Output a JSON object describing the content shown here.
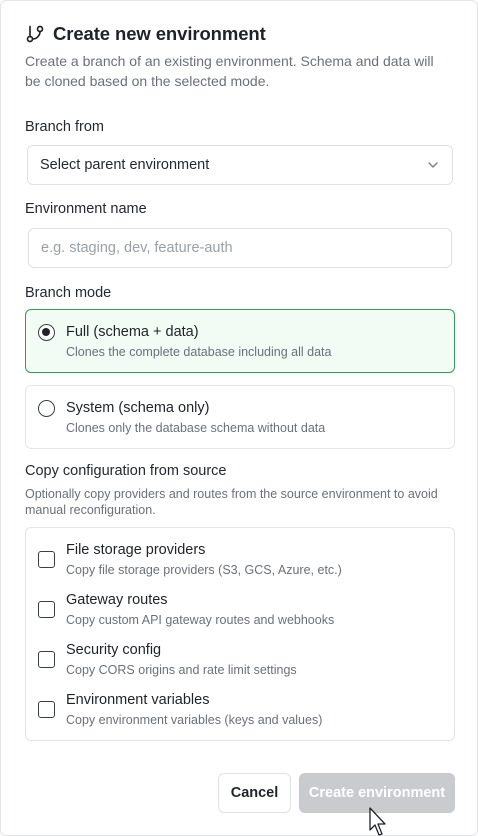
{
  "dialog": {
    "title": "Create new environment",
    "description": "Create a branch of an existing environment. Schema and data will be cloned based on the selected mode.",
    "icon": "git-branch-icon"
  },
  "branch_from": {
    "label": "Branch from",
    "value": "Select parent environment",
    "icon": "chevron-down-icon"
  },
  "env_name": {
    "label": "Environment name",
    "value": "",
    "placeholder": "e.g. staging, dev, feature-auth"
  },
  "branch_mode": {
    "label": "Branch mode",
    "options": [
      {
        "title": "Full (schema + data)",
        "subtitle": "Clones the complete database including all data",
        "selected": true
      },
      {
        "title": "System (schema only)",
        "subtitle": "Clones only the database schema without data",
        "selected": false
      }
    ]
  },
  "copy_config": {
    "label": "Copy configuration from source",
    "description": "Optionally copy providers and routes from the source environment to avoid manual reconfiguration.",
    "options": [
      {
        "title": "File storage providers",
        "subtitle": "Copy file storage providers (S3, GCS, Azure, etc.)",
        "checked": false
      },
      {
        "title": "Gateway routes",
        "subtitle": "Copy custom API gateway routes and webhooks",
        "checked": false
      },
      {
        "title": "Security config",
        "subtitle": "Copy CORS origins and rate limit settings",
        "checked": false
      },
      {
        "title": "Environment variables",
        "subtitle": "Copy environment variables (keys and values)",
        "checked": false
      }
    ]
  },
  "actions": {
    "cancel_label": "Cancel",
    "create_label": "Create environment",
    "create_disabled": true
  },
  "colors": {
    "selected_border": "#2f9e5a",
    "selected_bg": "#f2fbf4",
    "disabled_button": "#c9cbce"
  }
}
